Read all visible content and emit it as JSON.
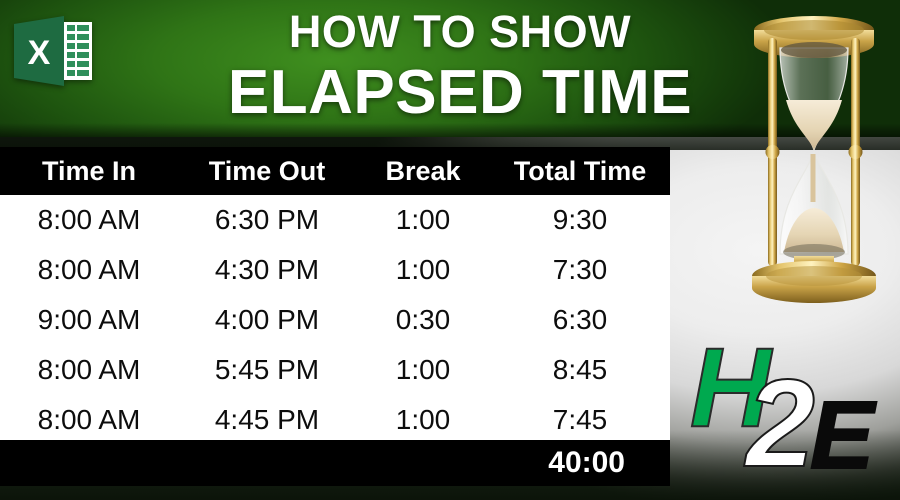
{
  "header": {
    "title_line1": "HOW TO SHOW",
    "title_line2": "ELAPSED TIME",
    "excel_icon_letter": "X",
    "brand_green": "#2f7416"
  },
  "logo": {
    "part_h": "H",
    "part_2": "2",
    "part_e": "E",
    "green": "#00a94f",
    "white": "#ffffff",
    "black": "#0a0a0a"
  },
  "table": {
    "columns": [
      "Time In",
      "Time Out",
      "Break",
      "Total Time"
    ],
    "rows": [
      [
        "8:00 AM",
        "6:30 PM",
        "1:00",
        "9:30"
      ],
      [
        "8:00 AM",
        "4:30 PM",
        "1:00",
        "7:30"
      ],
      [
        "9:00 AM",
        "4:00 PM",
        "0:30",
        "6:30"
      ],
      [
        "8:00 AM",
        "5:45 PM",
        "1:00",
        "8:45"
      ],
      [
        "8:00 AM",
        "4:45 PM",
        "1:00",
        "7:45"
      ]
    ],
    "total_label": "",
    "total_value": "40:00",
    "header_bg": "#000000",
    "body_bg": "#ffffff"
  },
  "icons": {
    "excel": "excel-icon",
    "hourglass": "hourglass-icon"
  }
}
